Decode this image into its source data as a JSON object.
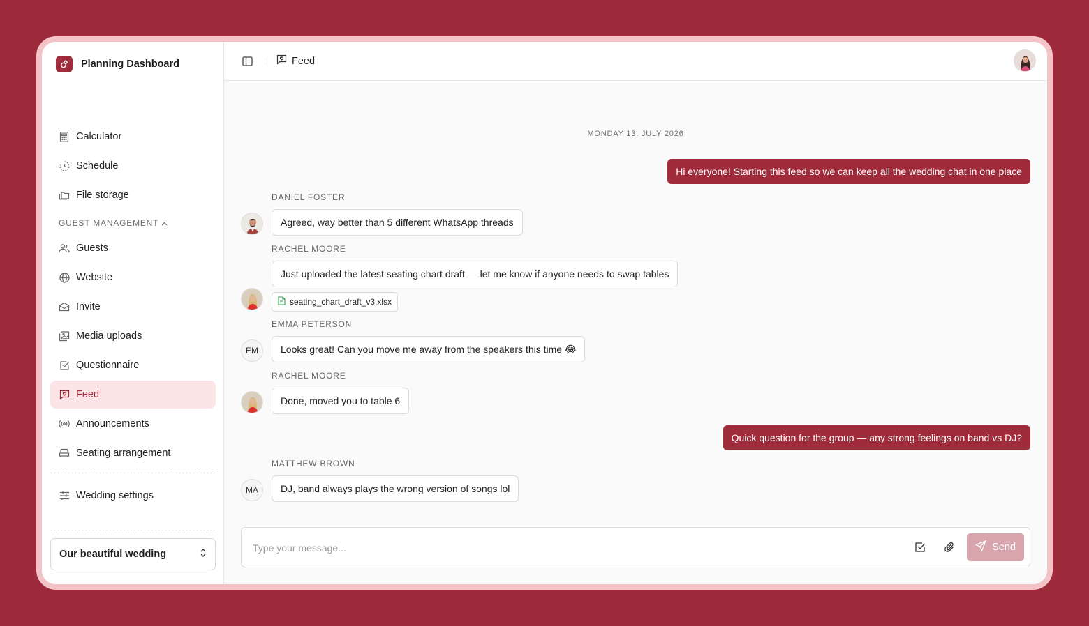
{
  "app": {
    "title": "Planning Dashboard"
  },
  "sidebar": {
    "items": [
      {
        "label": "Calculator",
        "icon": "calculator-icon"
      },
      {
        "label": "Schedule",
        "icon": "clock-icon"
      },
      {
        "label": "File storage",
        "icon": "folders-icon"
      }
    ],
    "section_label": "GUEST MANAGEMENT",
    "section_items": [
      {
        "label": "Guests",
        "icon": "users-icon"
      },
      {
        "label": "Website",
        "icon": "globe-icon"
      },
      {
        "label": "Invite",
        "icon": "envelope-icon"
      },
      {
        "label": "Media uploads",
        "icon": "images-icon"
      },
      {
        "label": "Questionnaire",
        "icon": "checkbox-icon"
      },
      {
        "label": "Feed",
        "icon": "message-icon",
        "active": true
      },
      {
        "label": "Announcements",
        "icon": "broadcast-icon"
      },
      {
        "label": "Seating arrangement",
        "icon": "sofa-icon"
      }
    ],
    "settings_label": "Wedding settings",
    "wedding_select": "Our beautiful wedding"
  },
  "header": {
    "breadcrumb": "Feed"
  },
  "feed": {
    "date": "MONDAY 13. JULY 2026",
    "messages": [
      {
        "outgoing": true,
        "text": "Hi everyone! Starting this feed so we can keep all the wedding chat in one place"
      },
      {
        "sender": "DANIEL FOSTER",
        "text": "Agreed, way better than 5 different WhatsApp threads"
      },
      {
        "sender": "RACHEL MOORE",
        "text": "Just uploaded the latest seating chart draft — let me know if anyone needs to swap tables",
        "attachment": "seating_chart_draft_v3.xlsx"
      },
      {
        "sender": "EMMA PETERSON",
        "initials": "EM",
        "text": "Looks great! Can you move me away from the speakers this time 😂"
      },
      {
        "sender": "RACHEL MOORE",
        "text": "Done, moved you to table 6"
      },
      {
        "outgoing": true,
        "text": "Quick question for the group — any strong feelings on band vs DJ?"
      },
      {
        "sender": "MATTHEW BROWN",
        "initials": "MA",
        "text": "DJ, band always plays the wrong version of songs lol"
      }
    ]
  },
  "composer": {
    "placeholder": "Type your message...",
    "send_label": "Send"
  },
  "colors": {
    "accent": "#a02c3b",
    "background": "#9d2a3a",
    "active_bg": "#fbe5e7",
    "send_disabled": "#d7a5ab"
  }
}
